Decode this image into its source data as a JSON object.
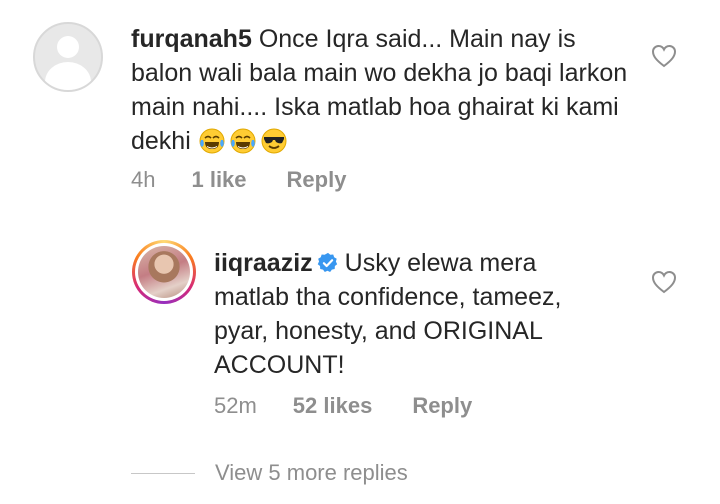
{
  "comments": [
    {
      "username": "furqanah5",
      "text": "Once Iqra said... Main nay is balon wali bala main wo dekha jo baqi larkon main nahi.... Iska matlab hoa ghairat ki kami dekhi",
      "emojis": [
        "laughing-crying-emoji",
        "laughing-crying-emoji",
        "sunglasses-emoji"
      ],
      "time": "4h",
      "likes": "1 like",
      "reply": "Reply"
    },
    {
      "username": "iiqraaziz",
      "verified": true,
      "text": "Usky elewa mera matlab tha confidence, tameez, pyar, honesty, and ORIGINAL ACCOUNT!",
      "time": "52m",
      "likes": "52 likes",
      "reply": "Reply"
    }
  ],
  "view_more": "View 5 more replies",
  "colors": {
    "text": "#262626",
    "secondary": "#8e8e8e",
    "verified": "#3897f0"
  },
  "icons": [
    "heart-outline-icon",
    "verified-badge-icon",
    "default-avatar-icon"
  ]
}
